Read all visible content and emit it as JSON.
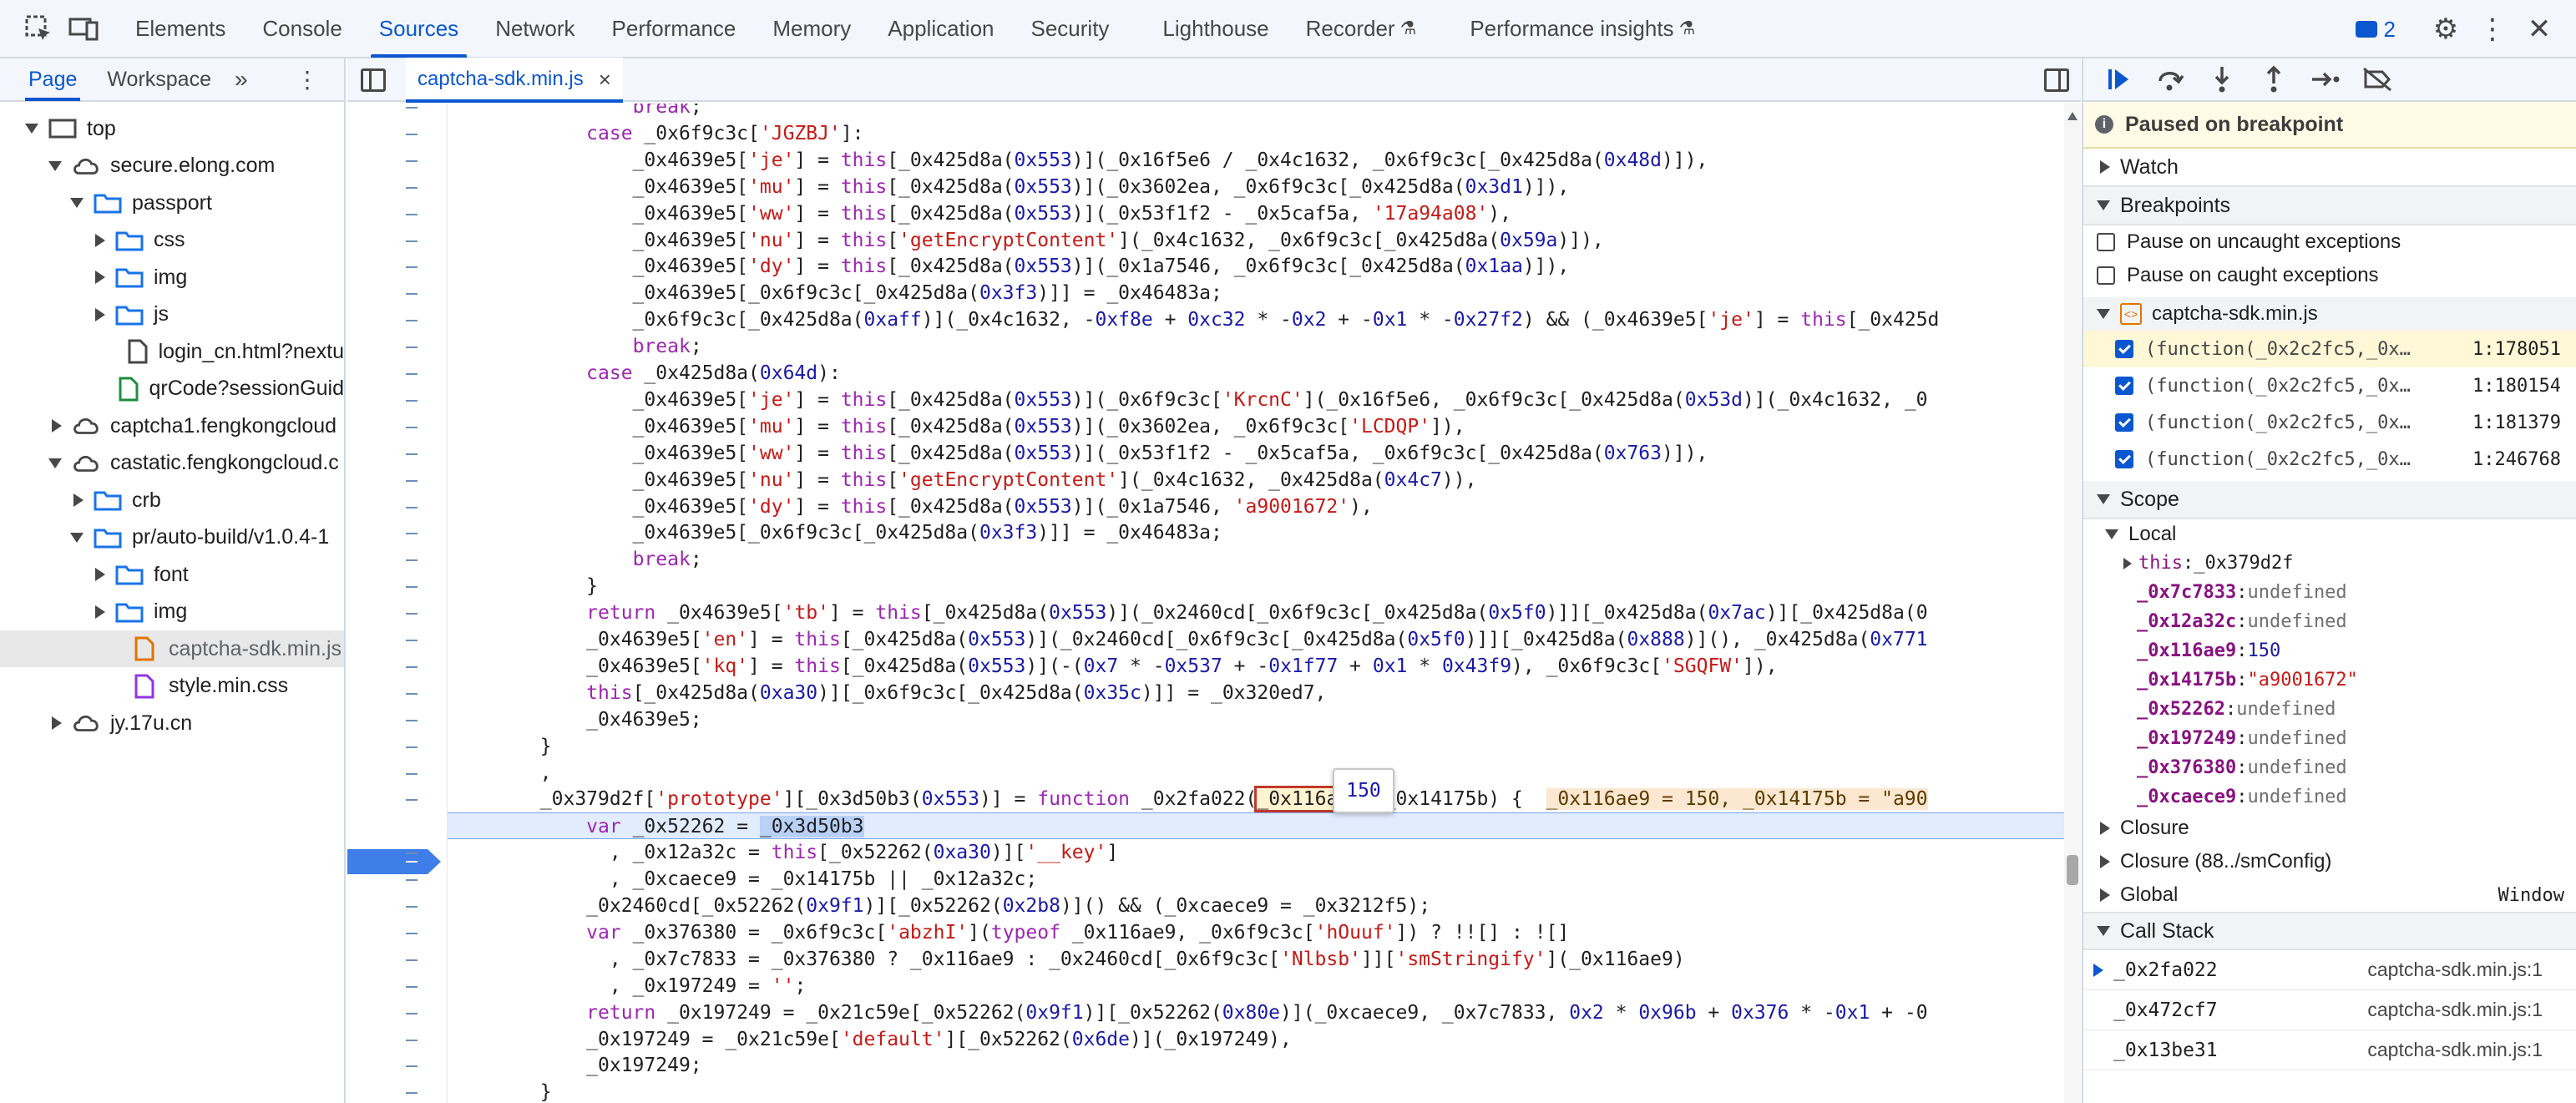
{
  "toolbar": {
    "tabs": [
      "Elements",
      "Console",
      "Sources",
      "Network",
      "Performance",
      "Memory",
      "Application",
      "Security",
      "Lighthouse",
      "Recorder",
      "Performance insights"
    ],
    "active_tab": "Sources",
    "issues_count": "2"
  },
  "navigator": {
    "tabs": [
      "Page",
      "Workspace"
    ],
    "more": "»",
    "tree": [
      {
        "label": "top"
      },
      {
        "label": "secure.elong.com"
      },
      {
        "label": "passport"
      },
      {
        "label": "css"
      },
      {
        "label": "img"
      },
      {
        "label": "js"
      },
      {
        "label": "login_cn.html?nextu"
      },
      {
        "label": "qrCode?sessionGuid"
      },
      {
        "label": "captcha1.fengkongcloud"
      },
      {
        "label": "castatic.fengkongcloud.c"
      },
      {
        "label": "crb"
      },
      {
        "label": "pr/auto-build/v1.0.4-1"
      },
      {
        "label": "font"
      },
      {
        "label": "img"
      },
      {
        "label": "captcha-sdk.min.js"
      },
      {
        "label": "style.min.css"
      },
      {
        "label": "jy.17u.cn"
      }
    ]
  },
  "editor": {
    "file_tab": "captcha-sdk.min.js",
    "close": "×",
    "tooltip_value": "150",
    "lines": [
      "                break;",
      "            case _0x6f9c3c['JGZBJ']:",
      "                _0x4639e5['je'] = this[_0x425d8a(0x553)](_0x16f5e6 / _0x4c1632, _0x6f9c3c[_0x425d8a(0x48d)]),",
      "                _0x4639e5['mu'] = this[_0x425d8a(0x553)](_0x3602ea, _0x6f9c3c[_0x425d8a(0x3d1)]),",
      "                _0x4639e5['ww'] = this[_0x425d8a(0x553)](_0x53f1f2 - _0x5caf5a, '17a94a08'),",
      "                _0x4639e5['nu'] = this['getEncryptContent'](_0x4c1632, _0x6f9c3c[_0x425d8a(0x59a)]),",
      "                _0x4639e5['dy'] = this[_0x425d8a(0x553)](_0x1a7546, _0x6f9c3c[_0x425d8a(0x1aa)]),",
      "                _0x4639e5[_0x6f9c3c[_0x425d8a(0x3f3)]] = _0x46483a;",
      "                _0x6f9c3c[_0x425d8a(0xaff)](_0x4c1632, -0xf8e + 0xc32 * -0x2 + -0x1 * -0x27f2) && (_0x4639e5['je'] = this[_0x425d",
      "                break;",
      "            case _0x425d8a(0x64d):",
      "                _0x4639e5['je'] = this[_0x425d8a(0x553)](_0x6f9c3c['KrcnC'](_0x16f5e6, _0x6f9c3c[_0x425d8a(0x53d)](_0x4c1632, _0",
      "                _0x4639e5['mu'] = this[_0x425d8a(0x553)](_0x3602ea, _0x6f9c3c['LCDQP']),",
      "                _0x4639e5['ww'] = this[_0x425d8a(0x553)](_0x53f1f2 - _0x5caf5a, _0x6f9c3c[_0x425d8a(0x763)]),",
      "                _0x4639e5['nu'] = this['getEncryptContent'](_0x4c1632, _0x425d8a(0x4c7)),",
      "                _0x4639e5['dy'] = this[_0x425d8a(0x553)](_0x1a7546, 'a9001672'),",
      "                _0x4639e5[_0x6f9c3c[_0x425d8a(0x3f3)]] = _0x46483a;",
      "                break;",
      "            }",
      "            return _0x4639e5['tb'] = this[_0x425d8a(0x553)](_0x2460cd[_0x6f9c3c[_0x425d8a(0x5f0)]][_0x425d8a(0x7ac)][_0x425d8a(0",
      "            _0x4639e5['en'] = this[_0x425d8a(0x553)](_0x2460cd[_0x6f9c3c[_0x425d8a(0x5f0)]][_0x425d8a(0x888)](), _0x425d8a(0x771",
      "            _0x4639e5['kq'] = this[_0x425d8a(0x553)](-(0x7 * -0x537 + -0x1f77 + 0x1 * 0x43f9), _0x6f9c3c['SGQFW']),",
      "            this[_0x425d8a(0xa30)][_0x6f9c3c[_0x425d8a(0x35c)]] = _0x320ed7,",
      "            _0x4639e5;",
      "        }",
      "        ,",
      "        _0x379d2f['prototype'][_0x3d50b3(0x553)] = function _0x2fa022(_0x116ae9, _0x14175b) {  _0x116ae9 = 150, _0x14175b = \"a90",
      "            var _0x52262 = _0x3d50b3",
      "              , _0x12a32c = this[_0x52262(0xa30)]['__key']",
      "              , _0xcaece9 = _0x14175b || _0x12a32c;",
      "            _0x2460cd[_0x52262(0x9f1)][_0x52262(0x2b8)]() && (_0xcaece9 = _0x3212f5);",
      "            var _0x376380 = _0x6f9c3c['abzhI'](typeof _0x116ae9, _0x6f9c3c['hOuuf']) ? !![] : ![]",
      "              , _0x7c7833 = _0x376380 ? _0x116ae9 : _0x2460cd[_0x6f9c3c['Nlbsb']]['smStringify'](_0x116ae9)",
      "              , _0x197249 = '';",
      "            return _0x197249 = _0x21c59e[_0x52262(0x9f1)][_0x52262(0x80e)](_0xcaece9, _0x7c7833, 0x2 * 0x96b + 0x376 * -0x1 + -0",
      "            _0x197249 = _0x21c59e['default'][_0x52262(0x6de)](_0x197249),",
      "            _0x197249;",
      "        }"
    ]
  },
  "debugger": {
    "paused_text": "Paused on breakpoint",
    "watch": "Watch",
    "breakpoints": "Breakpoints",
    "pause_uncaught": "Pause on uncaught exceptions",
    "pause_caught": "Pause on caught exceptions",
    "bp_file": "captcha-sdk.min.js",
    "bp_items": [
      {
        "code": "(function(_0x2c2fc5,_0x…",
        "loc": "1:178051"
      },
      {
        "code": "(function(_0x2c2fc5,_0x…",
        "loc": "1:180154"
      },
      {
        "code": "(function(_0x2c2fc5,_0x…",
        "loc": "1:181379"
      },
      {
        "code": "(function(_0x2c2fc5,_0x…",
        "loc": "1:246768"
      }
    ],
    "scope": "Scope",
    "local": "Local",
    "scope_vars": [
      {
        "name": "this",
        "value": "_0x379d2f",
        "kind": "obj"
      },
      {
        "name": "_0x7c7833",
        "value": "undefined",
        "kind": "u"
      },
      {
        "name": "_0x12a32c",
        "value": "undefined",
        "kind": "u"
      },
      {
        "name": "_0x116ae9",
        "value": "150",
        "kind": "n"
      },
      {
        "name": "_0x14175b",
        "value": "\"a9001672\"",
        "kind": "s"
      },
      {
        "name": "_0x52262",
        "value": "undefined",
        "kind": "u"
      },
      {
        "name": "_0x197249",
        "value": "undefined",
        "kind": "u"
      },
      {
        "name": "_0x376380",
        "value": "undefined",
        "kind": "u"
      },
      {
        "name": "_0xcaece9",
        "value": "undefined",
        "kind": "u"
      }
    ],
    "closure": "Closure",
    "closure2": "Closure (88../smConfig)",
    "global": "Global",
    "global_val": "Window",
    "call_stack": "Call Stack",
    "frames": [
      {
        "fn": "_0x2fa022",
        "loc": "captcha-sdk.min.js:1"
      },
      {
        "fn": "_0x472cf7",
        "loc": "captcha-sdk.min.js:1"
      },
      {
        "fn": "_0x13be31",
        "loc": "captcha-sdk.min.js:1"
      }
    ]
  },
  "colors": {
    "accent": "#0b57d0",
    "exec_line": "#e1ecfd",
    "annotation": "#e03a2e"
  }
}
